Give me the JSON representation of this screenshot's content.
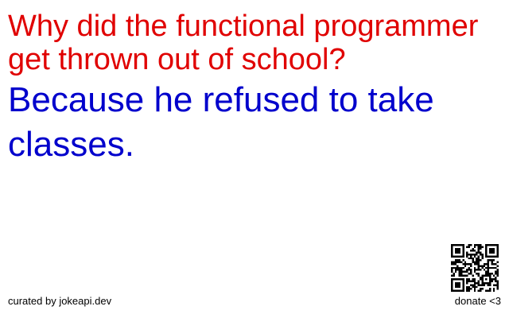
{
  "joke": {
    "setup": "Why did the functional programmer get thrown out of school?",
    "delivery": "Because he refused to take classes.",
    "setup_color": "#e00000",
    "delivery_color": "#0000cc"
  },
  "footer": {
    "credit": "curated by jokeapi.dev",
    "donate": "donate <3"
  },
  "icons": {
    "qr": "qr-code-icon"
  }
}
